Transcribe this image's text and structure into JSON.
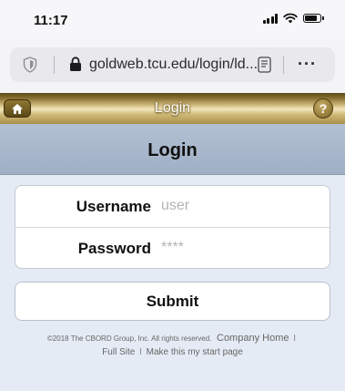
{
  "status_bar": {
    "time": "11:17",
    "icons": [
      "signal-icon",
      "wifi-icon",
      "battery-icon"
    ]
  },
  "browser": {
    "url": "goldweb.tcu.edu/login/ld...",
    "more_label": "···",
    "icons": [
      "shield-icon",
      "lock-icon",
      "reader-icon"
    ]
  },
  "header": {
    "title": "Login",
    "help_label": "?",
    "home_icon": "home-icon"
  },
  "page": {
    "title": "Login"
  },
  "form": {
    "username_label": "Username",
    "username_placeholder": "user",
    "password_label": "Password",
    "password_placeholder": "****",
    "submit_label": "Submit"
  },
  "footer": {
    "copyright": "©2018 The CBORD Group, Inc. All rights reserved.",
    "company_home": "Company Home",
    "full_site": "Full Site",
    "make_start_page": "Make this my start page",
    "separator": "I"
  },
  "colors": {
    "header_gold": "#d8c488",
    "title_bar": "#a9b8cc",
    "page_bg": "#e5ebf5"
  }
}
